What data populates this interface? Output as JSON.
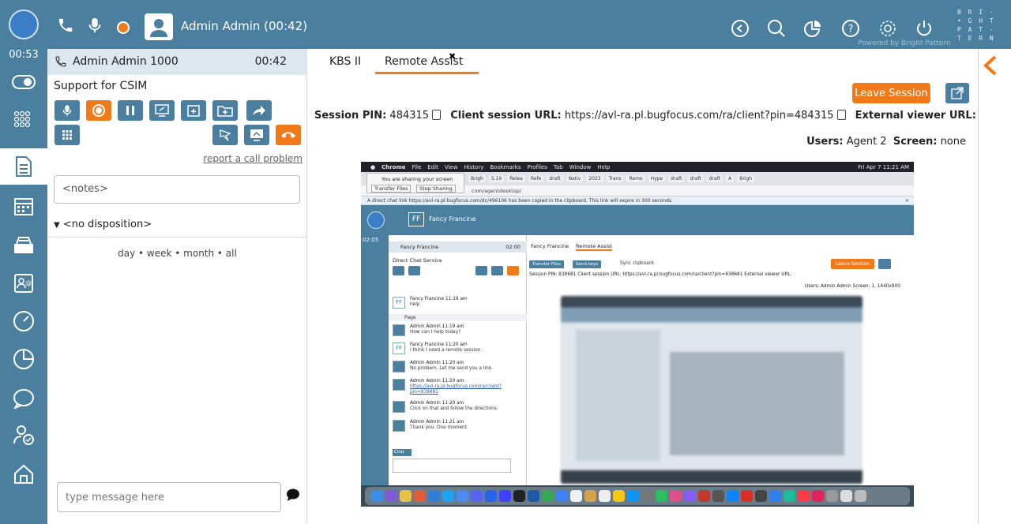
{
  "topbar": {
    "caller_name": "Admin Admin  (00:42)",
    "powered": "Powered by Bright Pattern",
    "brand": "B R I -\n• G H T\nP A T -\nT E R N",
    "icons": [
      "phone-icon",
      "microphone-icon",
      "record-dot-icon",
      "user-avatar-icon",
      "chat-bubble-icon",
      "search-icon",
      "pie-chart-icon",
      "help-icon",
      "settings-gear-icon",
      "power-icon"
    ]
  },
  "leftnav": {
    "timer": "00:53",
    "items": [
      "toggle-icon",
      "dialpad-icon",
      "document-icon",
      "calendar-icon",
      "inbox-icon",
      "contact-card-icon",
      "dashboard-gauge-icon",
      "report-pie-icon",
      "chat-icon",
      "user-status-icon",
      "home-icon"
    ]
  },
  "call": {
    "name": "Admin Admin 1000",
    "time": "00:42",
    "service": "Support for CSIM",
    "report_link": "report a call problem",
    "notes_placeholder": "<notes>",
    "disposition": "<no disposition>",
    "history_filter": "day • week • month • all",
    "message_placeholder": "type message here"
  },
  "main": {
    "tabs": [
      {
        "label": "KBS II"
      },
      {
        "label": "Remote Assist"
      }
    ],
    "close_glyph": "✖",
    "leave_session": "Leave Session",
    "session_pin_label": "Session PIN:",
    "session_pin": "484315",
    "client_url_label": "Client session URL:",
    "client_url": "https://avl-ra.pl.bugfocus.com/ra/client?pin=484315",
    "external_url_label": "External viewer URL:",
    "users_label": "Users:",
    "users_value": "Agent 2",
    "screen_label": "Screen:",
    "screen_value": "none"
  },
  "shared_screen": {
    "menubar": [
      "Chrome",
      "File",
      "Edit",
      "View",
      "History",
      "Bookmarks",
      "Profiles",
      "Tab",
      "Window",
      "Help"
    ],
    "clock": "Fri Apr 7  11:21 AM",
    "tabs": [
      "Brigh",
      "5.19",
      "Relea",
      "Refe",
      "draft",
      "Nativ",
      "2023",
      "Trans",
      "Remo",
      "Hype",
      "draft",
      "draft",
      "draft",
      "A",
      "Brigh"
    ],
    "sharing_title": "You are sharing your screen",
    "transfer_files": "Transfer Files",
    "stop_sharing": "Stop Sharing",
    "url": "com/agentdesktop/",
    "notice": "A direct chat link https://avl-ra.pl.bugfocus.com/dc/496106 has been copied in the clipboard. This link will expire in 300 seconds.",
    "notice_close": "×",
    "inner_name": "Fancy Francine",
    "inner_ff": "FF",
    "inner_timer": "02:05",
    "inner_conv_name": "Fancy Francine",
    "inner_conv_time": "02:00",
    "inner_service": "Direct Chat Service",
    "inner_tab1": "Fancy Francine",
    "inner_tab2": "Remote Assist",
    "btn_transfer": "Transfer Files",
    "btn_send_keys": "Send keys",
    "sync_clipboard": "Sync clipboard",
    "inner_leave": "Leave Session",
    "inner_session": "Session PIN: 838681   Client session URL: https://avl-ra.pl.bugfocus.com/ra/client?pin=838681   External viewer URL:",
    "inner_users": "Users: Admin Admin  Screen: 1, 1440x900",
    "page_label": "Page",
    "chat_label": "Chat",
    "messages": [
      {
        "who": "Fancy Francine 11:19 am",
        "text": "help"
      },
      {
        "who": "Admin Admin 11:19 am",
        "text": "How can I help today?"
      },
      {
        "who": "Fancy Francine 11:20 am",
        "text": "I think I need a remote session."
      },
      {
        "who": "Admin Admin 11:20 am",
        "text": "No problem. Let me send you a link."
      },
      {
        "who": "Admin Admin 11:20 am",
        "text": "https://avl-ra.pl.bugfocus.com/ra/client?pin=838681"
      },
      {
        "who": "Admin Admin 11:20 am",
        "text": "Click on that and follow the directions."
      },
      {
        "who": "Admin Admin 11:21 am",
        "text": "Thank you. One moment."
      }
    ]
  },
  "colors": {
    "brand_blue": "#4a7fa0",
    "accent_orange": "#f07a1a",
    "status_blue": "#3b7ec8"
  }
}
